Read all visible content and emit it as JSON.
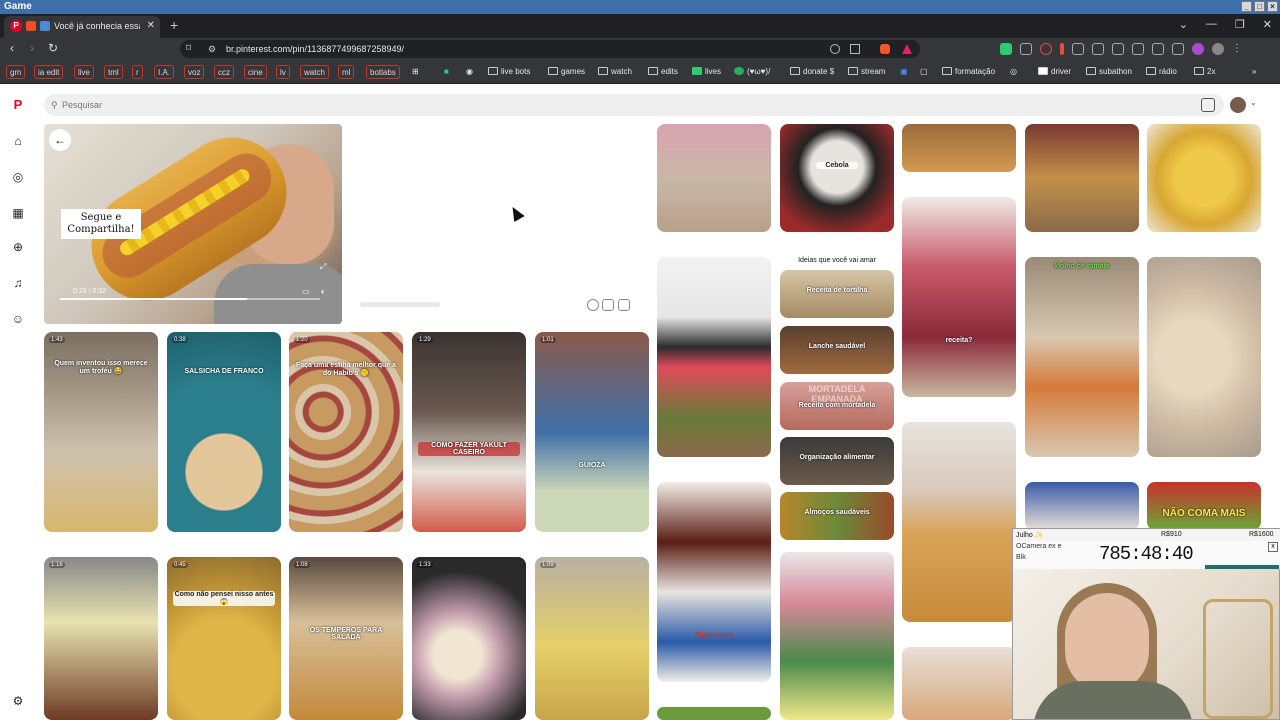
{
  "os": {
    "title": "Game"
  },
  "tab": {
    "label": "Você já conhecia essa sal...",
    "close": "✕",
    "new_tab": "+",
    "favicon": "P"
  },
  "nav": {
    "back": "‹",
    "forward": "›",
    "reload": "↻"
  },
  "address": {
    "url": "br.pinterest.com/pin/1136877499687258949/"
  },
  "bookmarks": [
    {
      "label": "gm",
      "boxed": true
    },
    {
      "label": "ia edit",
      "boxed": true
    },
    {
      "label": "live",
      "boxed": true
    },
    {
      "label": "tml",
      "boxed": true
    },
    {
      "label": "r",
      "boxed": true
    },
    {
      "label": "I.A.",
      "boxed": true
    },
    {
      "label": "voz",
      "boxed": true
    },
    {
      "label": "ccz",
      "boxed": true
    },
    {
      "label": "cine",
      "boxed": true
    },
    {
      "label": "lv",
      "boxed": true
    },
    {
      "label": "watch",
      "boxed": true
    },
    {
      "label": "ml",
      "boxed": true
    },
    {
      "label": "botlabs",
      "boxed": true
    },
    {
      "label": "live bots",
      "boxed": false
    },
    {
      "label": "games",
      "boxed": false
    },
    {
      "label": "watch",
      "boxed": false
    },
    {
      "label": "edits",
      "boxed": false
    },
    {
      "label": "lives",
      "boxed": false
    },
    {
      "label": "(♥ω♥)/",
      "boxed": false
    },
    {
      "label": "donate $",
      "boxed": false
    },
    {
      "label": "stream",
      "boxed": false
    },
    {
      "label": "formatação",
      "boxed": false
    },
    {
      "label": "driver",
      "boxed": false
    },
    {
      "label": "subathon",
      "boxed": false
    },
    {
      "label": "rádio",
      "boxed": false
    },
    {
      "label": "2x",
      "boxed": false
    }
  ],
  "search": {
    "placeholder": "Pesquisar"
  },
  "player": {
    "overlay_text": "Segue e Compartilha!",
    "time": "0:23 / 0:32",
    "progress": 0.72
  },
  "pins": {
    "row1": [
      {
        "badge": "1:43",
        "caption": "Quem inventou isso merece um troféu 😂"
      },
      {
        "badge": "0:38",
        "caption": "SALSICHA DE FRANCO"
      },
      {
        "badge": "1:20",
        "caption": "Faça uma esfiha melhor que a do Habib's 🤫"
      },
      {
        "badge": "1:29",
        "caption": "COMO FAZER YAKULT CASEIRO"
      },
      {
        "badge": "1:01",
        "caption": "GUIOZA"
      }
    ],
    "row2": [
      {
        "badge": "1:16",
        "caption": ""
      },
      {
        "badge": "0:45",
        "caption": "Como não pensei nisso antes 😱"
      },
      {
        "badge": "1:08",
        "caption": "OS TEMPEROS PARA SALADA"
      },
      {
        "badge": "1:33",
        "caption": ""
      },
      {
        "badge": "1:09",
        "caption": ""
      }
    ],
    "right": {
      "cebola": "Cebola",
      "receita": "receita?",
      "molho": "Molho de tomate",
      "nao_coma": "NÃO COMA MAIS",
      "pinracaquo": "Pinracaquo"
    }
  },
  "ideas": {
    "title": "Ideias que você vai amar",
    "cards": [
      "Receita de tortilha",
      "Lanche saudável",
      "Receita com mortadela",
      "Organização alimentar",
      "Almoços saudáveis"
    ],
    "mortadela_overlay": "MORTADELA EMPANADA"
  },
  "webcam": {
    "label1": "Julho ✨",
    "label2": "R$910",
    "label3": "R$1600",
    "sub1": "OCamera ex e",
    "sub2": "Blk",
    "timer": "785:48:40",
    "close": "x"
  }
}
